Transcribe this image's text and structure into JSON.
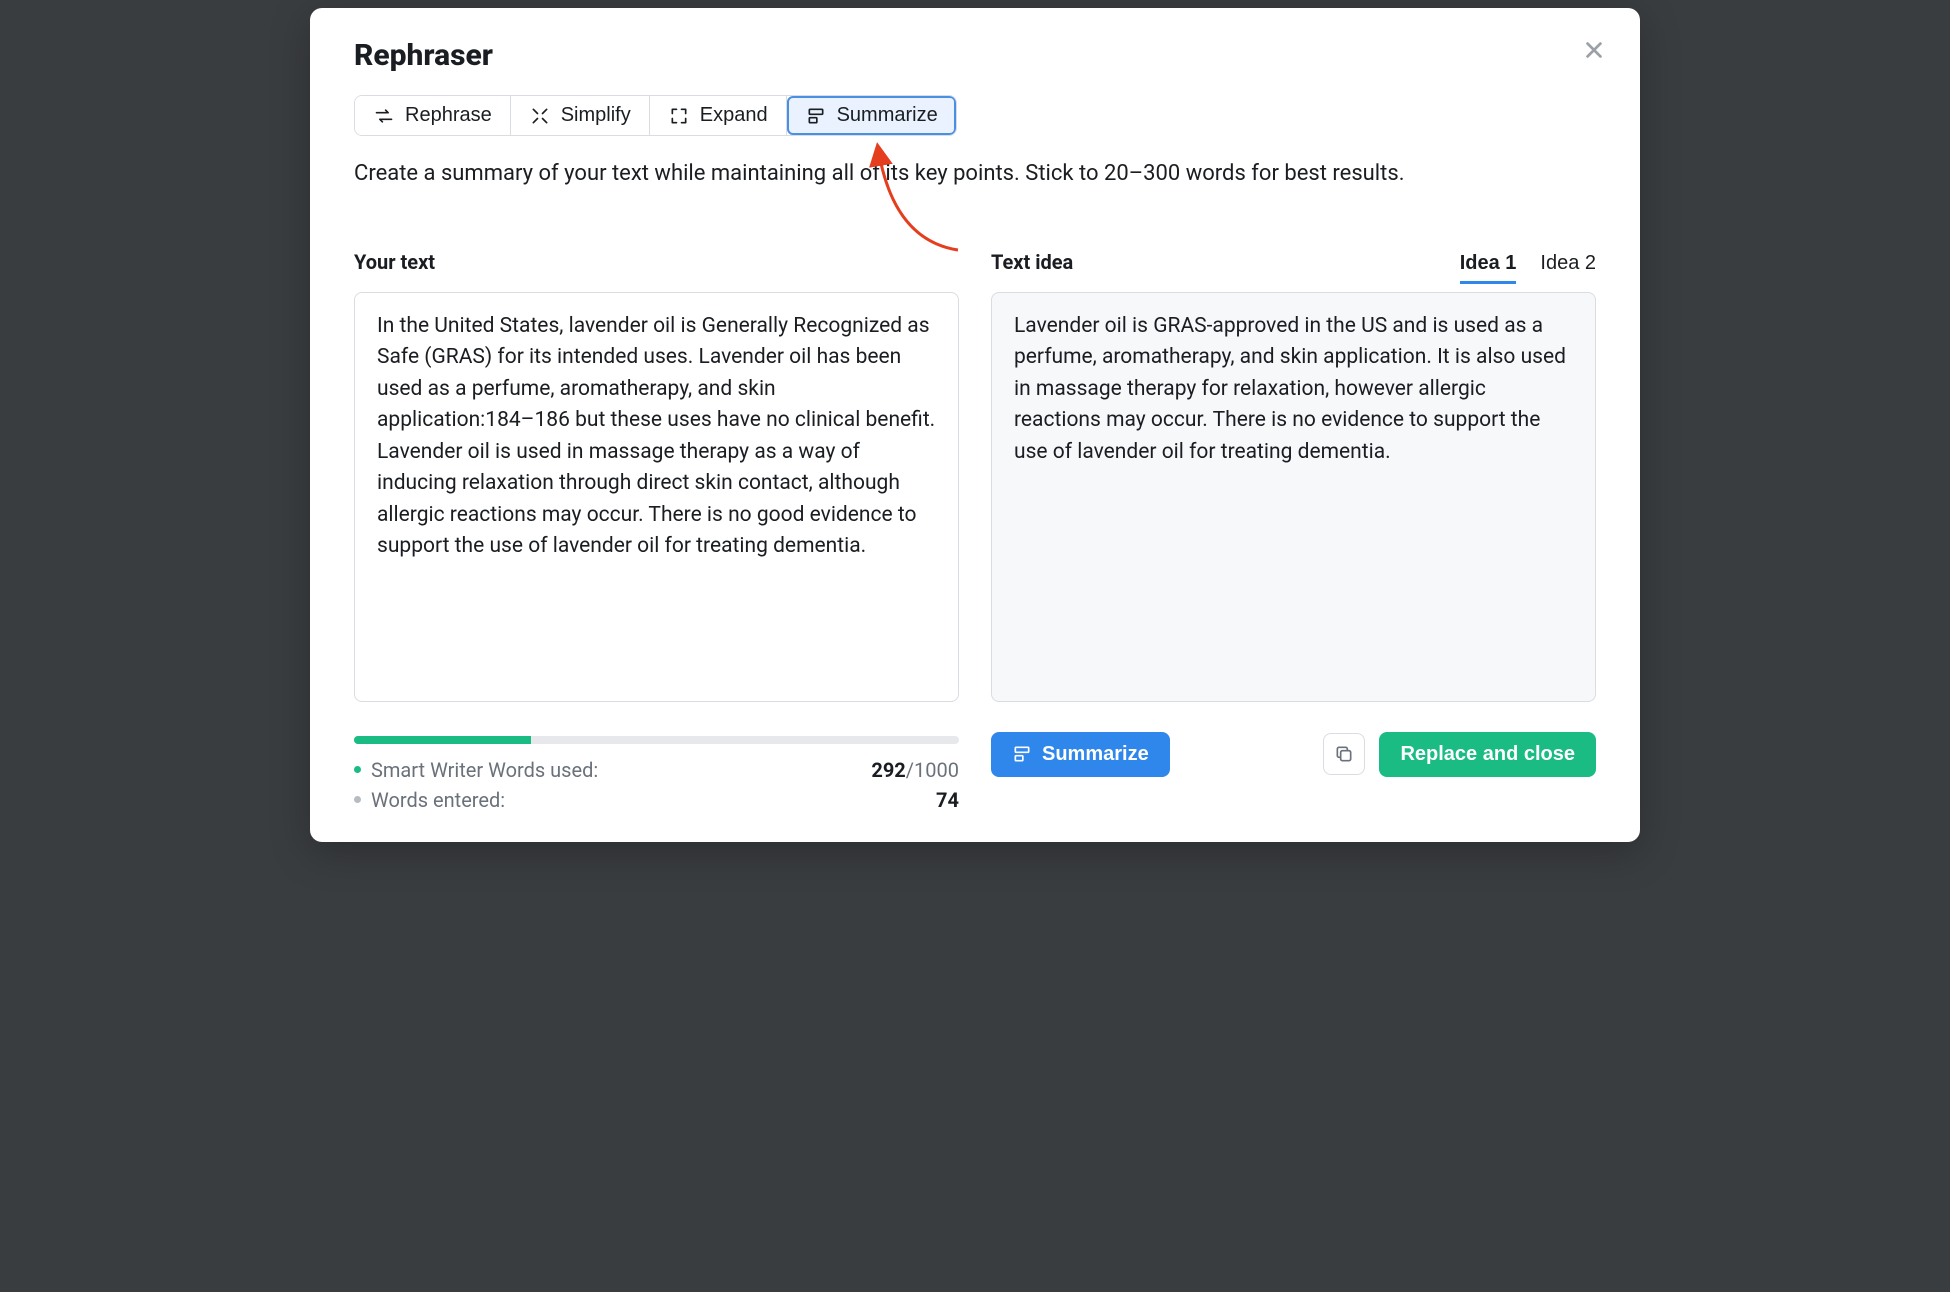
{
  "title": "Rephraser",
  "modes": {
    "rephrase": "Rephrase",
    "simplify": "Simplify",
    "expand": "Expand",
    "summarize": "Summarize"
  },
  "active_mode": "summarize",
  "description": "Create a summary of your text while maintaining all of its key points. Stick to 20–300 words for best results.",
  "left": {
    "label": "Your text",
    "value": "In the United States, lavender oil is Generally Recognized as Safe (GRAS) for its intended uses. Lavender oil has been used as a perfume, aromatherapy, and skin application:184–186 but these uses have no clinical benefit. Lavender oil is used in massage therapy as a way of inducing relaxation through direct skin contact, although allergic reactions may occur. There is no good evidence to support the use of lavender oil for treating dementia."
  },
  "right": {
    "label": "Text idea",
    "idea_tabs": [
      "Idea 1",
      "Idea 2"
    ],
    "active_idea": 0,
    "value": "Lavender oil is GRAS-approved in the US and is used as a perfume, aromatherapy, and skin application. It is also used in massage therapy for relaxation, however allergic reactions may occur. There is no evidence to support the use of lavender oil for treating dementia."
  },
  "stats": {
    "words_used_label": "Smart Writer Words used:",
    "words_used": "292",
    "words_limit": "/1000",
    "words_entered_label": "Words entered:",
    "words_entered": "74",
    "progress_percent": 29.2
  },
  "actions": {
    "summarize": "Summarize",
    "replace_close": "Replace and close"
  },
  "colors": {
    "primary": "#2f86eb",
    "success": "#1abc84"
  }
}
